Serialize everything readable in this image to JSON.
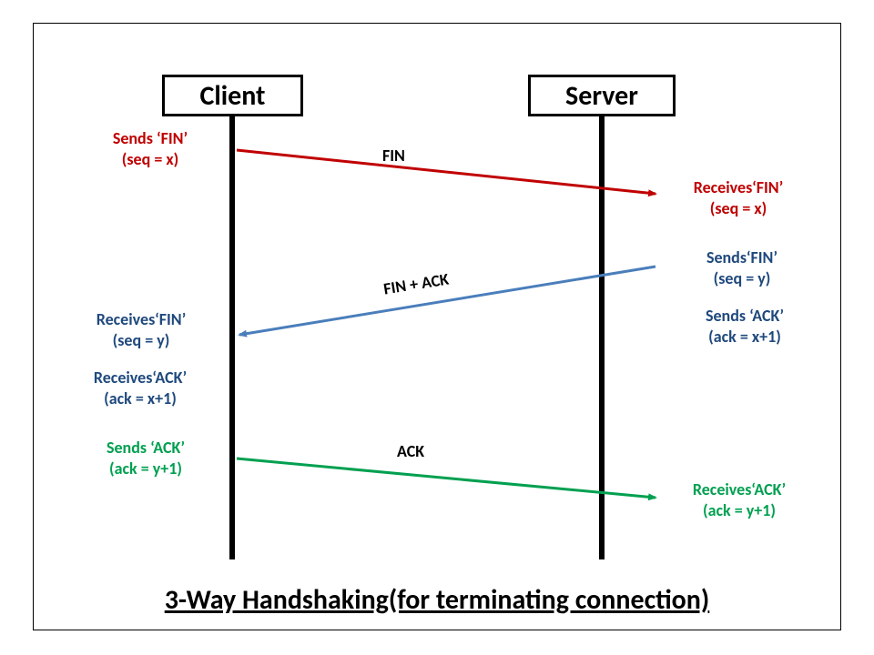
{
  "header": {
    "client": "Client",
    "server": "Server"
  },
  "messages": {
    "fin": "FIN",
    "finack": "FIN + ACK",
    "ack": "ACK"
  },
  "client": {
    "step1a": "Sends ‘FIN’",
    "step1b": "(seq = x)",
    "step2a": "Receives‘FIN’",
    "step2b": "(seq = y)",
    "step2c": "Receives‘ACK’",
    "step2d": "(ack = x+1)",
    "step3a": "Sends ‘ACK’",
    "step3b": "(ack = y+1)"
  },
  "server": {
    "step1a": "Receives‘FIN’",
    "step1b": "(seq = x)",
    "step2a": "Sends‘FIN’",
    "step2b": "(seq = y)",
    "step2c": "Sends ‘ACK’",
    "step2d": "(ack = x+1)",
    "step3a": "Receives‘ACK’",
    "step3b": "(ack = y+1)"
  },
  "caption": "3-Way Handshaking(for terminating connection)",
  "colors": {
    "fin": "#c00000",
    "finack": "#4a7ebb",
    "ack": "#00a050"
  }
}
